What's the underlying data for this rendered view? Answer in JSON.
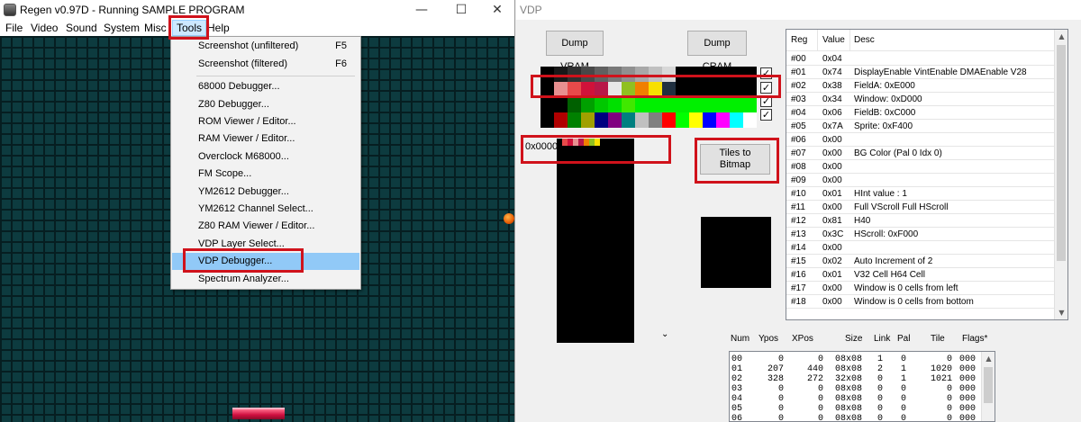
{
  "regen": {
    "title": "Regen v0.97D - Running SAMPLE PROGRAM",
    "controls": {
      "minimize": "—",
      "maximize": "☐",
      "close": "✕"
    },
    "menubar": [
      "File",
      "Video",
      "Sound",
      "System",
      "Misc",
      "Tools",
      "Help"
    ],
    "tools_menu": [
      {
        "label": "Screenshot (unfiltered)",
        "shortcut": "F5"
      },
      {
        "label": "Screenshot (filtered)",
        "shortcut": "F6"
      },
      {
        "label": "68000 Debugger...",
        "shortcut": ""
      },
      {
        "label": "Z80 Debugger...",
        "shortcut": ""
      },
      {
        "label": "ROM Viewer / Editor...",
        "shortcut": ""
      },
      {
        "label": "RAM Viewer / Editor...",
        "shortcut": ""
      },
      {
        "label": "Overclock M68000...",
        "shortcut": ""
      },
      {
        "label": "FM Scope...",
        "shortcut": ""
      },
      {
        "label": "YM2612 Debugger...",
        "shortcut": ""
      },
      {
        "label": "YM2612 Channel Select...",
        "shortcut": ""
      },
      {
        "label": "Z80 RAM Viewer / Editor...",
        "shortcut": ""
      },
      {
        "label": "VDP Layer Select...",
        "shortcut": ""
      },
      {
        "label": "VDP Debugger...",
        "shortcut": ""
      },
      {
        "label": "Spectrum Analyzer...",
        "shortcut": ""
      }
    ],
    "selected_menu_item": "VDP Debugger..."
  },
  "vdp": {
    "title": "VDP",
    "buttons": {
      "dump_vram": "Dump VRAM",
      "dump_cram": "Dump CRAM",
      "tiles_to_bitmap_1": "Tiles to",
      "tiles_to_bitmap_2": "Bitmap"
    },
    "checkbox_mark": "✓",
    "vram_address": "0x0000",
    "scroll_arrow": "⌄",
    "palette": [
      [
        "#000000",
        "#181818",
        "#303030",
        "#484848",
        "#606060",
        "#787878",
        "#909090",
        "#a8a8a8",
        "#c0c0c0",
        "#d8d8d8",
        "#000000",
        "#000000",
        "#000000",
        "#000000",
        "#000000",
        "#000000"
      ],
      [
        "#000000",
        "#e89090",
        "#e84a4a",
        "#d0123a",
        "#b81848",
        "#e8e8e8",
        "#90c020",
        "#f08000",
        "#f8e000",
        "#203040",
        "#000000",
        "#000000",
        "#000000",
        "#000000",
        "#000000",
        "#000000"
      ],
      [
        "#000000",
        "#000000",
        "#006000",
        "#00a000",
        "#00c800",
        "#00e000",
        "#40e800",
        "#00f000",
        "#00f000",
        "#00f000",
        "#00f000",
        "#00f000",
        "#00f000",
        "#00f000",
        "#00f000",
        "#00f000"
      ],
      [
        "#000000",
        "#b00000",
        "#008000",
        "#a0a000",
        "#000080",
        "#800080",
        "#008080",
        "#c0c0c0",
        "#808080",
        "#ff0000",
        "#00ff00",
        "#ffff00",
        "#0000ff",
        "#ff00ff",
        "#00ffff",
        "#ffffff"
      ]
    ],
    "vram_strip_colors": [
      "#000000",
      "#e84a4a",
      "#d0123a",
      "#e89090",
      "#b81848",
      "#f08000",
      "#90c020",
      "#f8e000",
      "#000000"
    ],
    "registers": {
      "headers": [
        "Reg",
        "Value",
        "Desc"
      ],
      "rows": [
        [
          "#00",
          "0x04",
          ""
        ],
        [
          "#01",
          "0x74",
          "DisplayEnable VintEnable DMAEnable V28"
        ],
        [
          "#02",
          "0x38",
          "FieldA: 0xE000"
        ],
        [
          "#03",
          "0x34",
          "Window: 0xD000"
        ],
        [
          "#04",
          "0x06",
          "FieldB: 0xC000"
        ],
        [
          "#05",
          "0x7A",
          "Sprite: 0xF400"
        ],
        [
          "#06",
          "0x00",
          ""
        ],
        [
          "#07",
          "0x00",
          "BG Color (Pal 0 Idx 0)"
        ],
        [
          "#08",
          "0x00",
          ""
        ],
        [
          "#09",
          "0x00",
          ""
        ],
        [
          "#10",
          "0x01",
          "HInt value : 1"
        ],
        [
          "#11",
          "0x00",
          " Full VScroll Full HScroll"
        ],
        [
          "#12",
          "0x81",
          " H40"
        ],
        [
          "#13",
          "0x3C",
          "HScroll: 0xF000"
        ],
        [
          "#14",
          "0x00",
          ""
        ],
        [
          "#15",
          "0x02",
          "Auto Increment of 2"
        ],
        [
          "#16",
          "0x01",
          " V32 Cell H64 Cell"
        ],
        [
          "#17",
          "0x00",
          "Window is 0 cells from left"
        ],
        [
          "#18",
          "0x00",
          "Window is 0 cells from bottom"
        ]
      ]
    },
    "sprites": {
      "headers": [
        "Num",
        "Ypos",
        "XPos",
        "Size",
        "Link",
        "Pal",
        "Tile",
        "Flags*"
      ],
      "rows": [
        [
          "00",
          "0",
          "0",
          "08x08",
          "1",
          "0",
          "0",
          "000"
        ],
        [
          "01",
          "207",
          "440",
          "08x08",
          "2",
          "1",
          "1020",
          "000"
        ],
        [
          "02",
          "328",
          "272",
          "32x08",
          "0",
          "1",
          "1021",
          "000"
        ],
        [
          "03",
          "0",
          "0",
          "08x08",
          "0",
          "0",
          "0",
          "000"
        ],
        [
          "04",
          "0",
          "0",
          "08x08",
          "0",
          "0",
          "0",
          "000"
        ],
        [
          "05",
          "0",
          "0",
          "08x08",
          "0",
          "0",
          "0",
          "000"
        ],
        [
          "06",
          "0",
          "0",
          "08x08",
          "0",
          "0",
          "0",
          "000"
        ]
      ]
    }
  }
}
